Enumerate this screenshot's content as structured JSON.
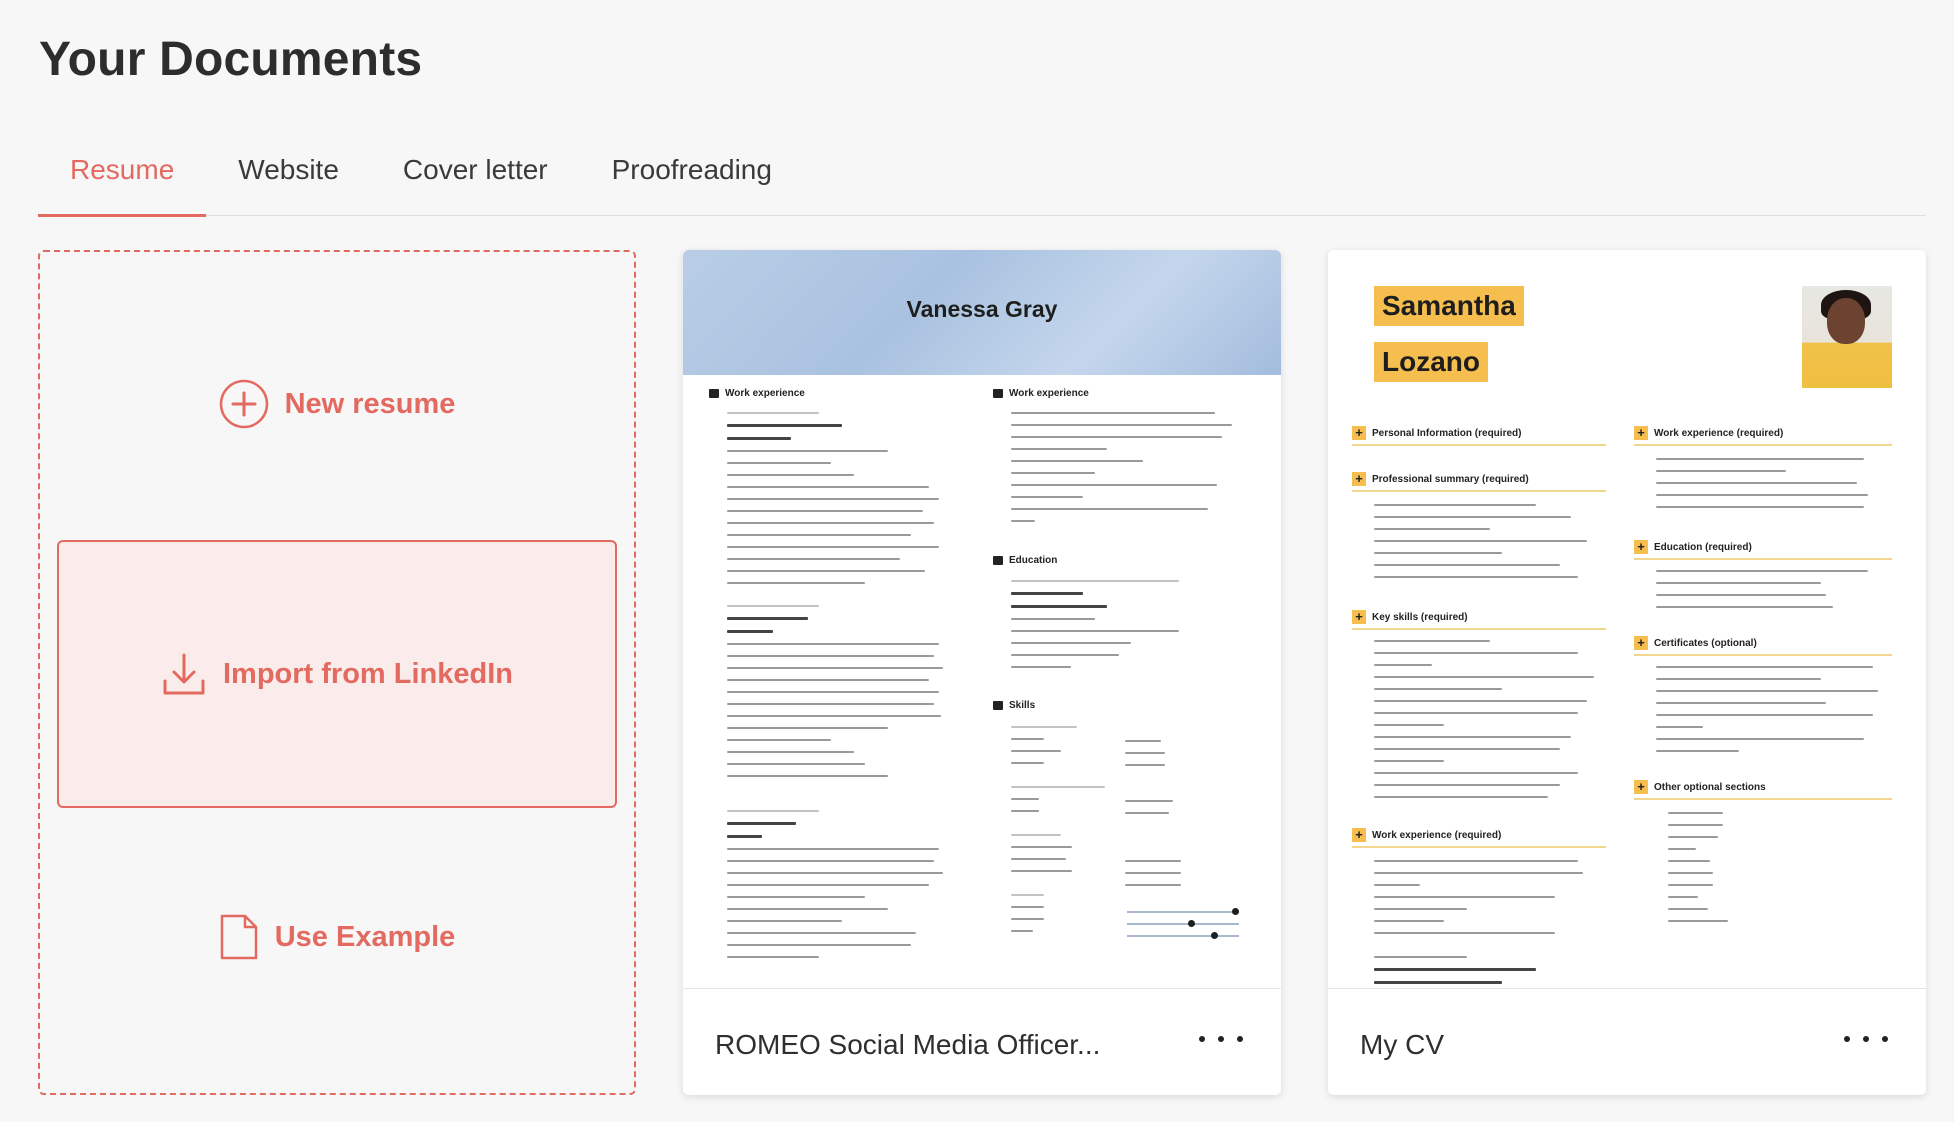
{
  "page": {
    "title": "Your Documents"
  },
  "tabs": [
    {
      "label": "Resume",
      "active": true
    },
    {
      "label": "Website",
      "active": false
    },
    {
      "label": "Cover letter",
      "active": false
    },
    {
      "label": "Proofreading",
      "active": false
    }
  ],
  "create": {
    "new_resume_label": "New resume",
    "import_label": "Import from LinkedIn",
    "use_example_label": "Use Example"
  },
  "documents": [
    {
      "name": "ROMEO Social Media Officer...",
      "preview": {
        "person_name": "Vanessa Gray",
        "sections_left": [
          "Work experience"
        ],
        "sections_right": [
          "Work experience",
          "Education",
          "Skills"
        ]
      }
    },
    {
      "name": "My CV",
      "preview": {
        "first_name": "Samantha",
        "last_name": "Lozano",
        "sections_left": [
          "Personal Information (required)",
          "Professional summary (required)",
          "Key skills (required)",
          "Work experience (required)"
        ],
        "sections_right": [
          "Work experience (required)",
          "Education (required)",
          "Certificates (optional)",
          "Other optional sections"
        ]
      }
    }
  ],
  "colors": {
    "accent": "#e26a60",
    "accent_bg": "#f9eceb",
    "highlight_yellow": "#f6bd4f",
    "header_blue": "#b9cde6"
  },
  "icons": {
    "new_resume": "plus-circle-icon",
    "import": "download-icon",
    "use_example": "document-icon",
    "more": "more-icon"
  }
}
